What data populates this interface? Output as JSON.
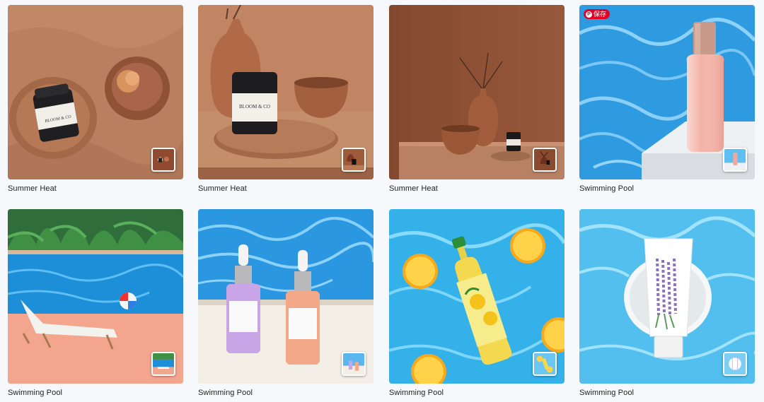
{
  "grid": {
    "cards": [
      {
        "caption": "Summer Heat",
        "label_text": "BLOOM & CO"
      },
      {
        "caption": "Summer Heat",
        "label_text": "BLOOM & CO"
      },
      {
        "caption": "Summer Heat"
      },
      {
        "caption": "Swimming Pool",
        "save_badge": "保存"
      },
      {
        "caption": "Swimming Pool"
      },
      {
        "caption": "Swimming Pool"
      },
      {
        "caption": "Swimming Pool"
      },
      {
        "caption": "Swimming Pool"
      }
    ]
  },
  "colors": {
    "page_bg": "#f6f8fb",
    "terracotta": "#b77b58",
    "pool_blue": "#3aa6e6",
    "pin_red": "#e60023"
  },
  "icons": [
    "pinterest-logo-icon",
    "thumbnail-preview-icon"
  ]
}
